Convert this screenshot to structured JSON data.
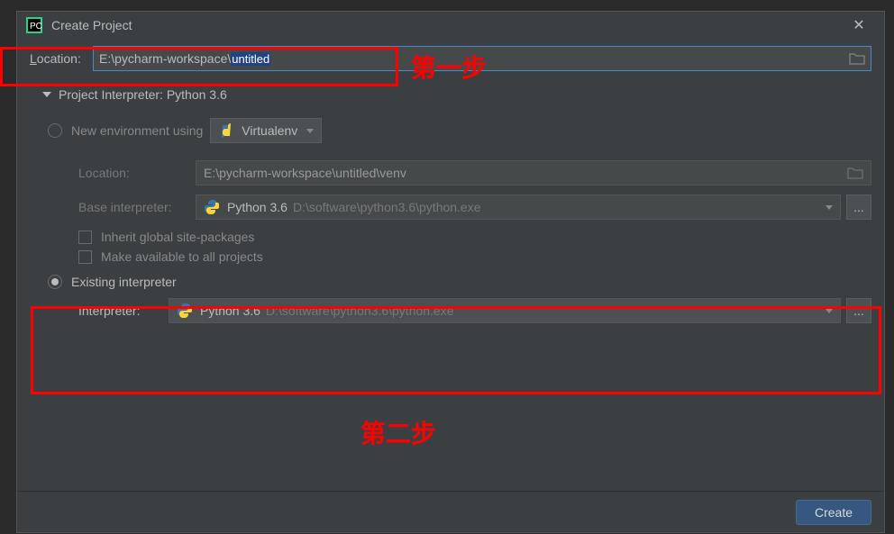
{
  "titlebar": {
    "title": "Create Project"
  },
  "location": {
    "label_prefix": "L",
    "label_rest": "ocation:",
    "value_prefix": "E:\\pycharm-workspace\\",
    "value_selected": "untitled"
  },
  "interp_header": "Project Interpreter: Python 3.6",
  "new_env": {
    "radio_label": "New environment using",
    "dropdown": "Virtualenv",
    "location_label": "Location:",
    "location_value": "E:\\pycharm-workspace\\untitled\\venv",
    "base_label": "Base interpreter:",
    "base_name": "Python 3.6",
    "base_path": "D:\\software\\python3.6\\python.exe",
    "inherit": "Inherit global site-packages",
    "make_avail": "Make available to all projects"
  },
  "existing": {
    "radio_label": "Existing interpreter",
    "interp_label": "Interpreter:",
    "interp_name": "Python 3.6",
    "interp_path": "D:\\software\\python3.6\\python.exe"
  },
  "annotations": {
    "step1": "第一步",
    "step2": "第二步"
  },
  "footer": {
    "create": "Create"
  },
  "ellipsis": "..."
}
